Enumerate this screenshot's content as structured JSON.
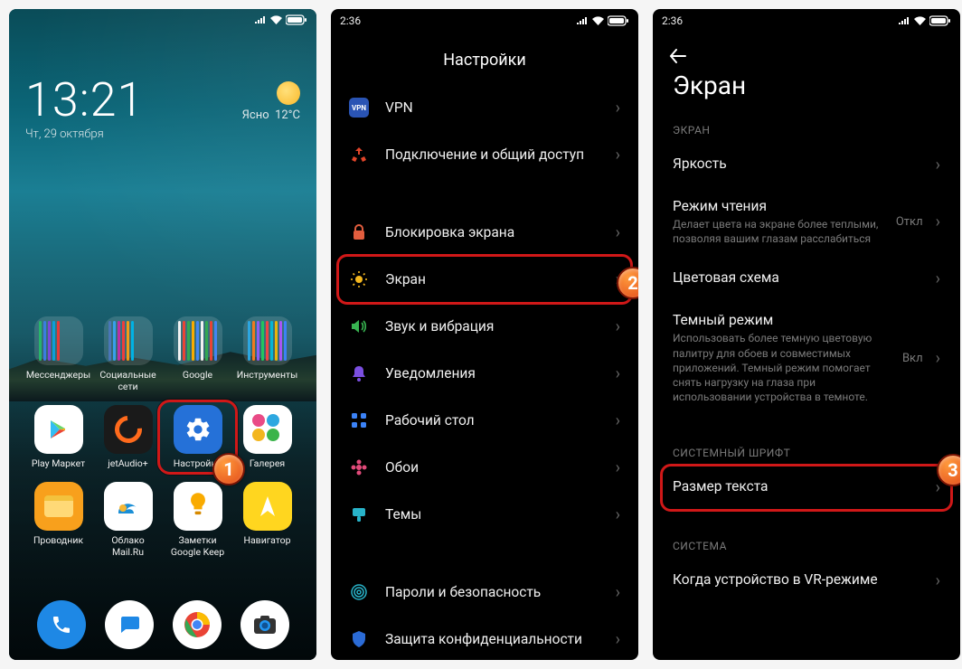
{
  "phone1": {
    "status": {
      "signal": "▮",
      "wifi": "⏚",
      "battery": "▭"
    },
    "clock": {
      "time": "13:21",
      "date": "Чт, 29 октября"
    },
    "weather": {
      "cond": "Ясно",
      "temp": "12°C"
    },
    "folders": {
      "messengers": "Мессенджеры",
      "social": "Социальные сети",
      "google": "Google",
      "tools": "Инструменты"
    },
    "apps": {
      "playmarket": "Play Маркет",
      "jetaudio": "jetAudio+",
      "settings": "Настройки",
      "gallery": "Галерея",
      "explorer": "Проводник",
      "mailru": "Облако\nMail.Ru",
      "keep": "Заметки\nGoogle Keep",
      "navigator": "Навигатор"
    }
  },
  "phone2": {
    "time": "2:36",
    "title": "Настройки",
    "items": [
      {
        "label": "VPN"
      },
      {
        "label": "Подключение и общий доступ"
      },
      {
        "label": "Блокировка экрана"
      },
      {
        "label": "Экран"
      },
      {
        "label": "Звук и вибрация"
      },
      {
        "label": "Уведомления"
      },
      {
        "label": "Рабочий стол"
      },
      {
        "label": "Обои"
      },
      {
        "label": "Темы"
      },
      {
        "label": "Пароли и безопасность"
      },
      {
        "label": "Защита конфиденциальности"
      }
    ]
  },
  "phone3": {
    "time": "2:36",
    "title": "Экран",
    "section1": "ЭКРАН",
    "rows": {
      "brightness": "Яркость",
      "reading": {
        "label": "Режим чтения",
        "sub": "Делает цвета на экране более теплыми, позволяя вашим глазам расслабиться",
        "val": "Откл"
      },
      "color": "Цветовая схема",
      "dark": {
        "label": "Темный режим",
        "sub": "Использовать более темную цветовую палитру для обоев и совместимых приложений. Темный режим помогает снять нагрузку на глаза при использовании устройства в темноте.",
        "val": "Вкл"
      }
    },
    "section2": "СИСТЕМНЫЙ ШРИФТ",
    "textsize": "Размер текста",
    "section3": "СИСТЕМА",
    "vr": "Когда устройство в VR-режиме"
  },
  "steps": {
    "s1": "1",
    "s2": "2",
    "s3": "3"
  }
}
